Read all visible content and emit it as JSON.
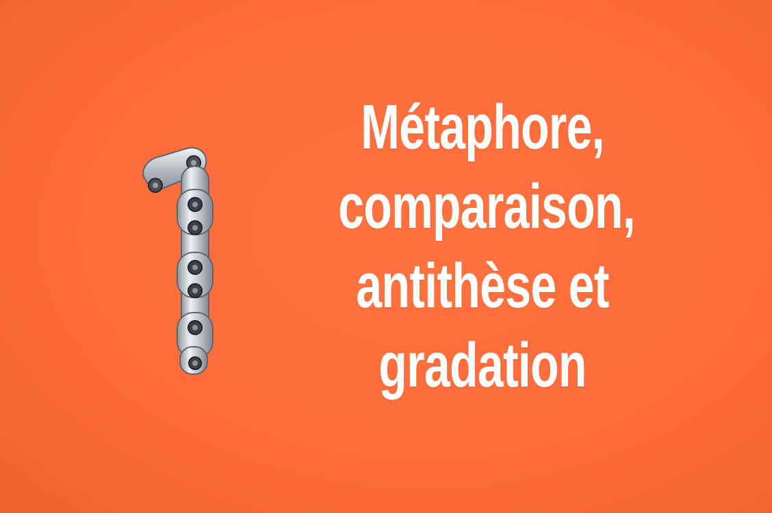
{
  "headline": {
    "lines": [
      "Métaphore,",
      "comparaison,",
      "antithèse et",
      "gradation"
    ]
  },
  "image": {
    "subject": "bike-chain-number-one-icon"
  },
  "colors": {
    "background": "#ff6e3a",
    "text": "#ffffff",
    "chain_metal": "#cfd3d8",
    "chain_dark": "#2d2f33"
  }
}
